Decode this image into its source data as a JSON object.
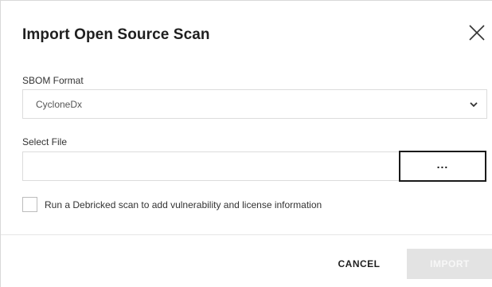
{
  "dialog": {
    "title": "Import Open Source Scan",
    "close_icon": "close-icon"
  },
  "sbom": {
    "label": "SBOM Format",
    "selected": "CycloneDx",
    "chevron_icon": "chevron-down-icon"
  },
  "file": {
    "label": "Select File",
    "value": "",
    "browse_label": "..."
  },
  "debricked": {
    "checked": false,
    "label": "Run a Debricked scan to add vulnerability and license information"
  },
  "footer": {
    "cancel_label": "CANCEL",
    "import_label": "IMPORT",
    "import_enabled": false
  },
  "colors": {
    "title_text": "#1f1f1f",
    "border": "#dcdcdc",
    "browse_border": "#1a1a1a",
    "disabled_button_bg": "#e3e3e3",
    "disabled_button_text": "#f7f7f7"
  }
}
